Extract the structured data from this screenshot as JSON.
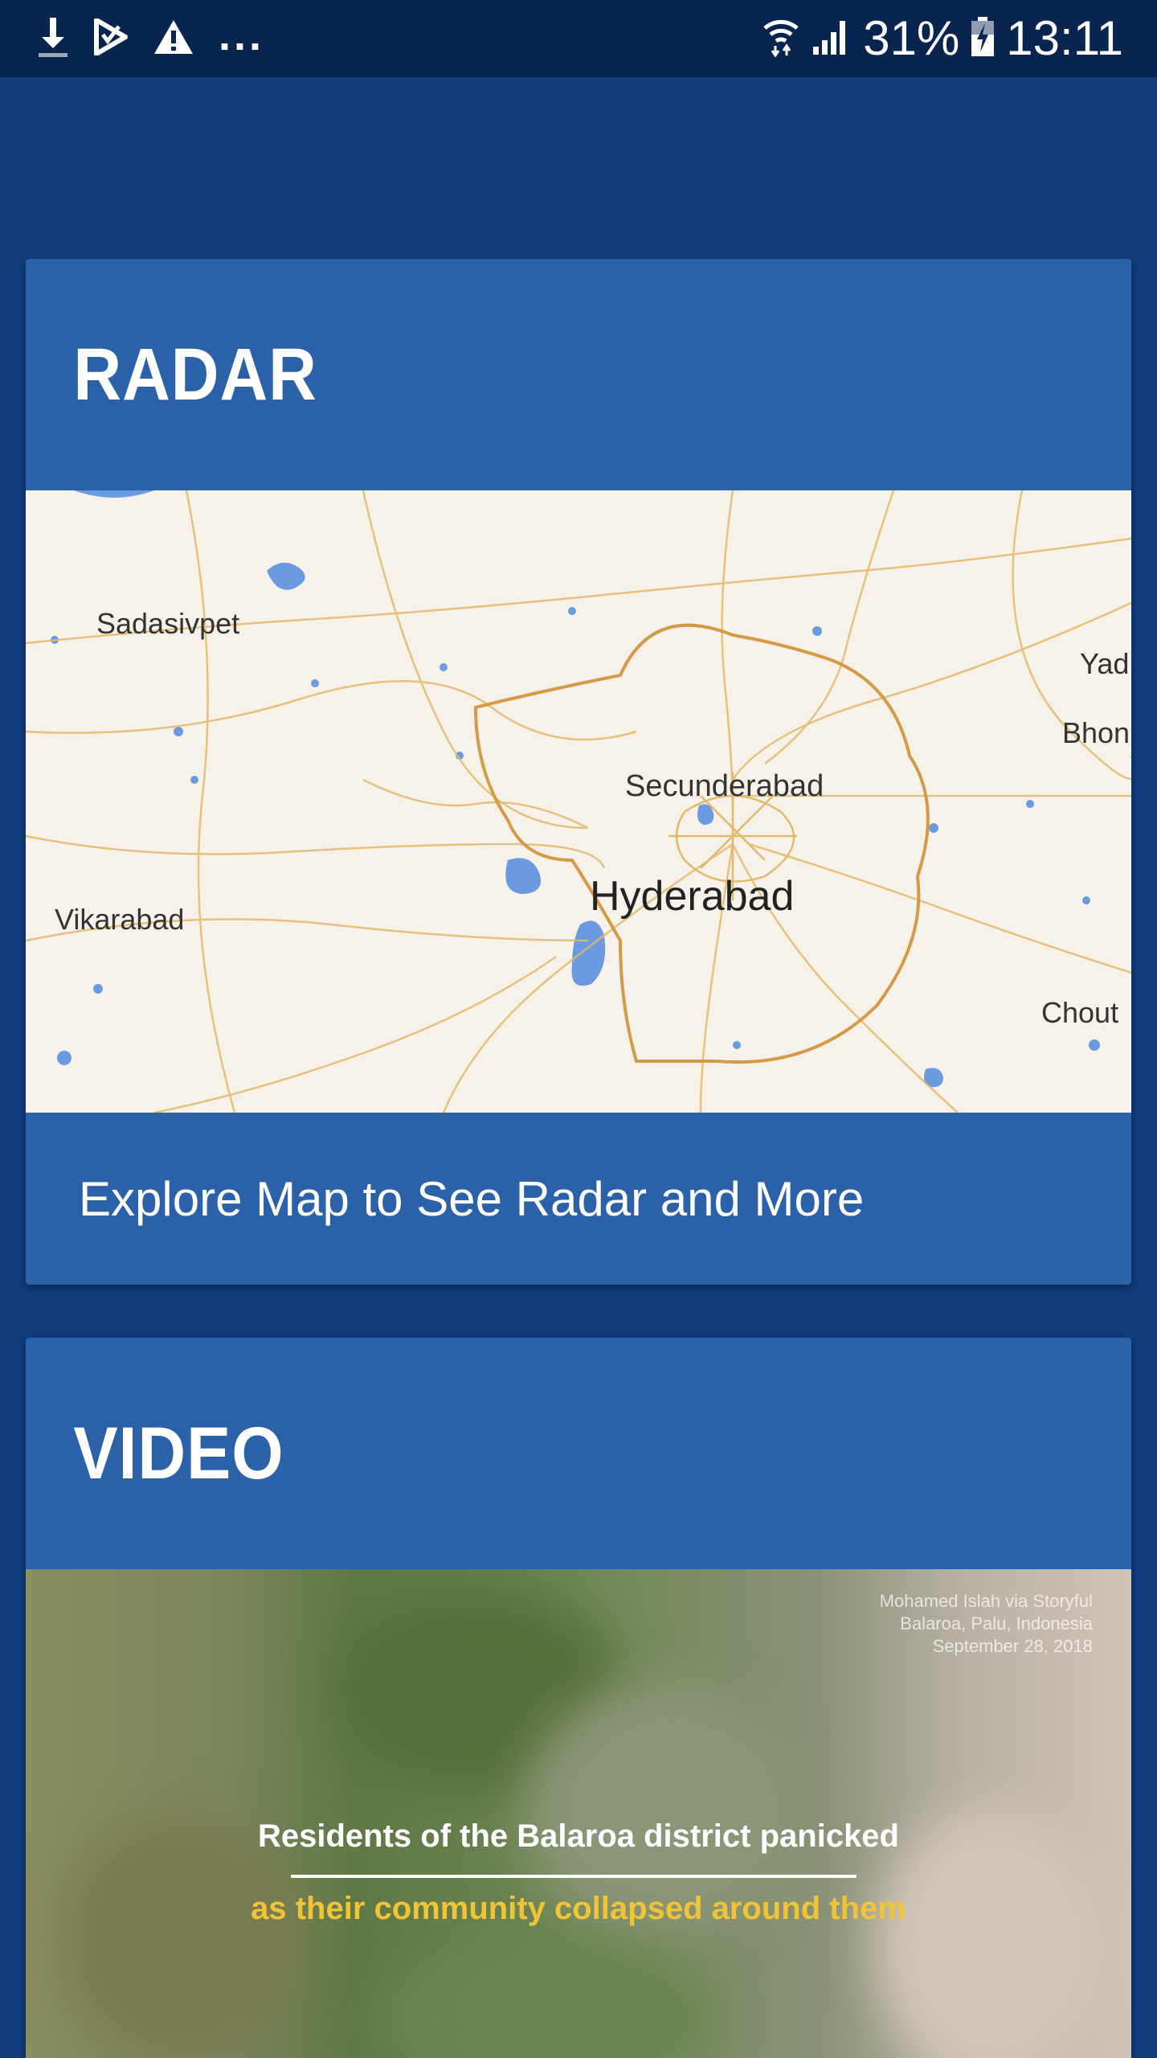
{
  "status_bar": {
    "battery": "31%",
    "time": "13:11",
    "more": "...",
    "icons": [
      "download-icon",
      "play-store-icon",
      "warning-icon",
      "wifi-icon",
      "signal-icon",
      "battery-charging-icon"
    ]
  },
  "radar_card": {
    "title": "RADAR",
    "footer": "Explore Map to See Radar and More",
    "map_labels": {
      "sadasivpet": "Sadasivpet",
      "secunderabad": "Secunderabad",
      "hyderabad": "Hyderabad",
      "vikarabad": "Vikarabad",
      "yad": "Yad",
      "bhon": "Bhon",
      "chout": "Chout"
    }
  },
  "video_card": {
    "title": "VIDEO",
    "credit": [
      "Mohamed Islah via Storyful",
      "Balaroa, Palu, Indonesia",
      "September 28, 2018"
    ],
    "caption_line1": "Residents of the Balaroa district panicked",
    "caption_line2": "as their community collapsed around them"
  },
  "colors": {
    "background": "#0f3d7c",
    "status_bar": "#0a2450",
    "card": "#2a61a9",
    "map_land": "#f6f2e9",
    "map_road": "#e2b96a",
    "map_water": "#6a9be0",
    "caption_highlight": "#f0c437"
  }
}
